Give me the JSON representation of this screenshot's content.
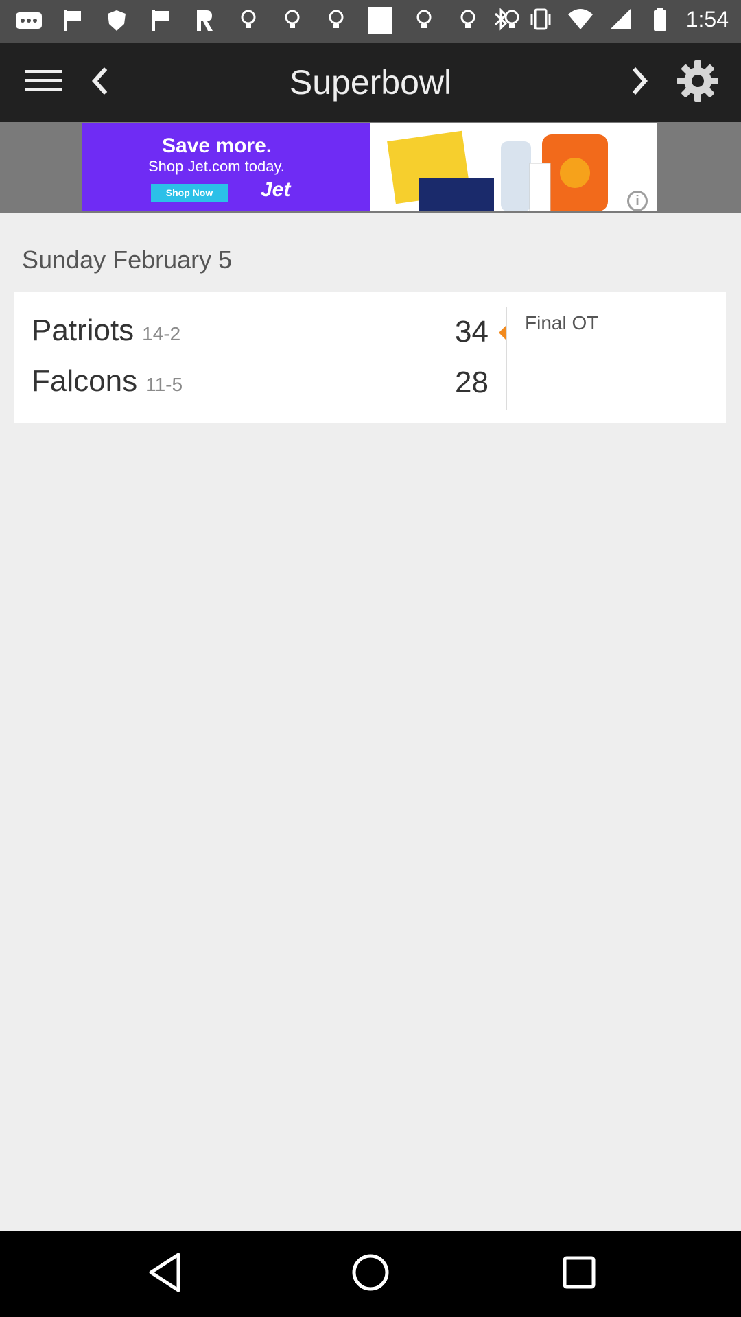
{
  "status_bar": {
    "time": "1:54",
    "left_icons": [
      "more-icon",
      "flag-icon",
      "shield-icon",
      "flag-icon",
      "r-app-icon",
      "lightbulb-icon",
      "lightbulb-icon",
      "lightbulb-icon",
      "square-icon",
      "lightbulb-icon",
      "lightbulb-icon",
      "lightbulb-icon"
    ],
    "right_icons": [
      "bluetooth-icon",
      "vibrate-icon",
      "wifi-icon",
      "signal-icon",
      "battery-icon"
    ]
  },
  "toolbar": {
    "title": "Superbowl",
    "menu_icon": "menu-icon",
    "prev_icon": "chevron-left-icon",
    "next_icon": "chevron-right-icon",
    "settings_icon": "gear-icon"
  },
  "ad": {
    "headline": "Save more.",
    "subline": "Shop Jet.com today.",
    "cta": "Shop Now",
    "brand": "Jet"
  },
  "schedule": {
    "date_header": "Sunday February 5",
    "game": {
      "status": "Final OT",
      "teams": [
        {
          "name": "Patriots",
          "record": "14-2",
          "score": "34",
          "winner": true
        },
        {
          "name": "Falcons",
          "record": "11-5",
          "score": "28",
          "winner": false
        }
      ]
    }
  },
  "colors": {
    "toolbar": "#212121",
    "status_bar": "#4d4d4d",
    "background": "#eeeeee",
    "winner_marker": "#f28a1e",
    "ad_purple": "#6f2cf4"
  }
}
